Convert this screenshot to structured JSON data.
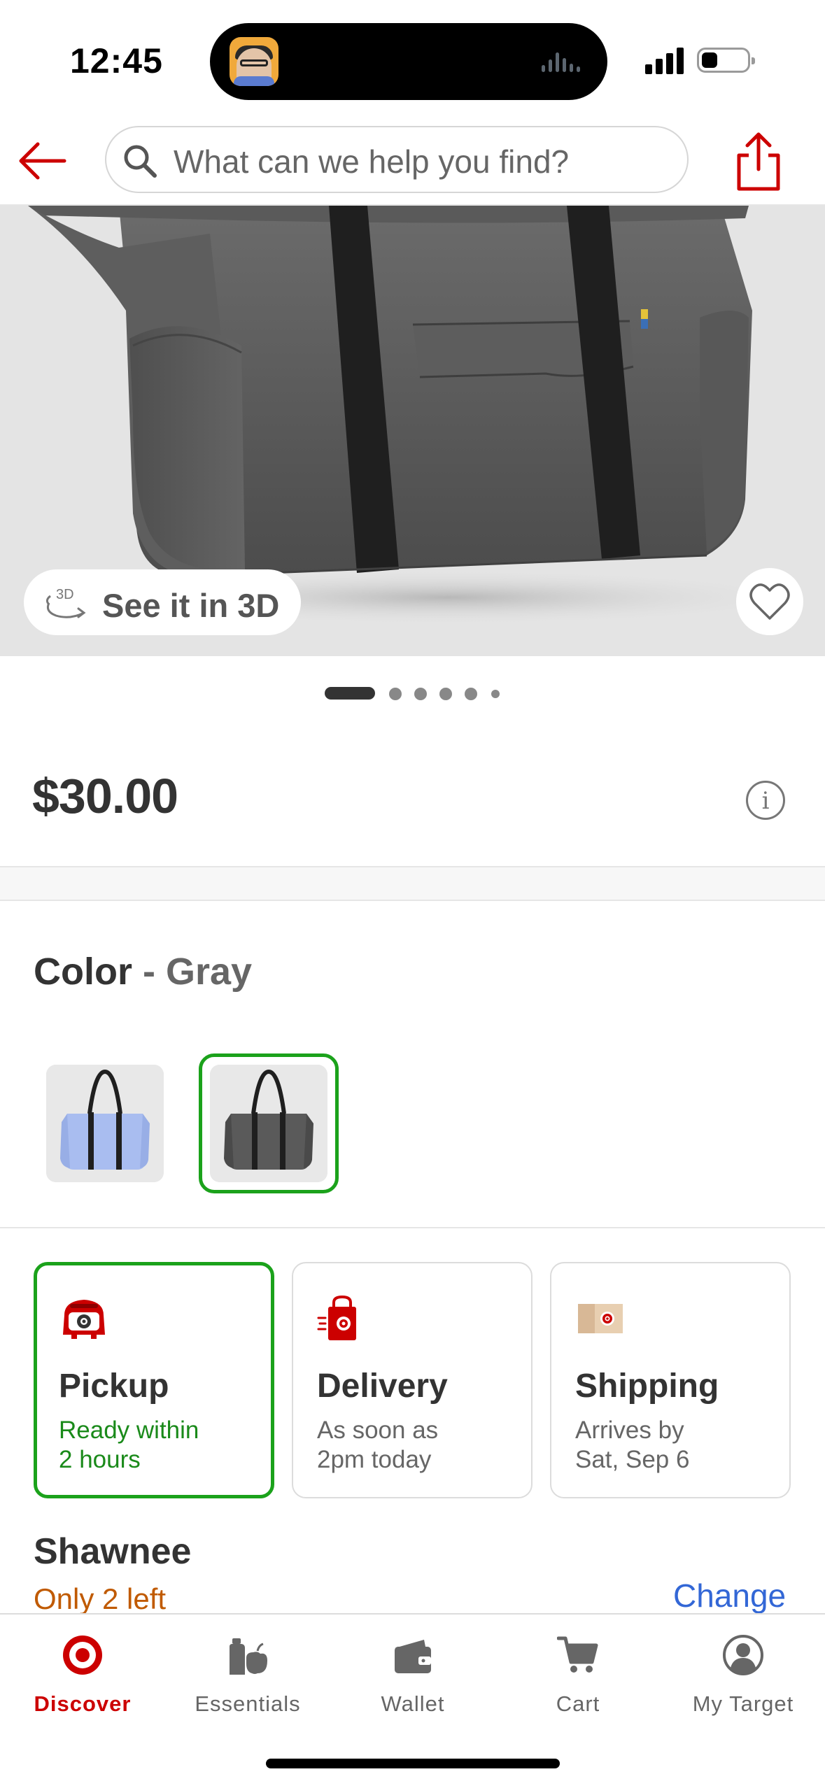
{
  "status_bar": {
    "time": "12:45"
  },
  "header": {
    "search_placeholder": "What can we help you find?"
  },
  "hero": {
    "see_3d_label": "See it in 3D",
    "image_count": 6,
    "active_image_index": 0
  },
  "product": {
    "price": "$30.00"
  },
  "color": {
    "label": "Color",
    "separator": " - ",
    "selected": "Gray",
    "swatches": [
      {
        "name": "Blue",
        "selected": false
      },
      {
        "name": "Gray",
        "selected": true
      }
    ]
  },
  "fulfillment": {
    "options": [
      {
        "title": "Pickup",
        "line1": "Ready within",
        "line2": "2 hours",
        "selected": true
      },
      {
        "title": "Delivery",
        "line1": "As soon as",
        "line2": "2pm today",
        "selected": false
      },
      {
        "title": "Shipping",
        "line1": "Arrives by",
        "line2": "Sat, Sep 6",
        "selected": false
      }
    ],
    "store_name": "Shawnee",
    "stock_text": "Only 2 left",
    "change_label": "Change"
  },
  "tabbar": {
    "tabs": [
      {
        "label": "Discover",
        "icon": "target-logo-icon",
        "active": true
      },
      {
        "label": "Essentials",
        "icon": "essentials-icon",
        "active": false
      },
      {
        "label": "Wallet",
        "icon": "wallet-icon",
        "active": false
      },
      {
        "label": "Cart",
        "icon": "cart-icon",
        "active": false
      },
      {
        "label": "My Target",
        "icon": "account-icon",
        "active": false
      }
    ]
  },
  "colors": {
    "brand_red": "#cc0000",
    "selected_green": "#1ba21b",
    "link_blue": "#3367d6",
    "stock_orange": "#c05a00"
  }
}
